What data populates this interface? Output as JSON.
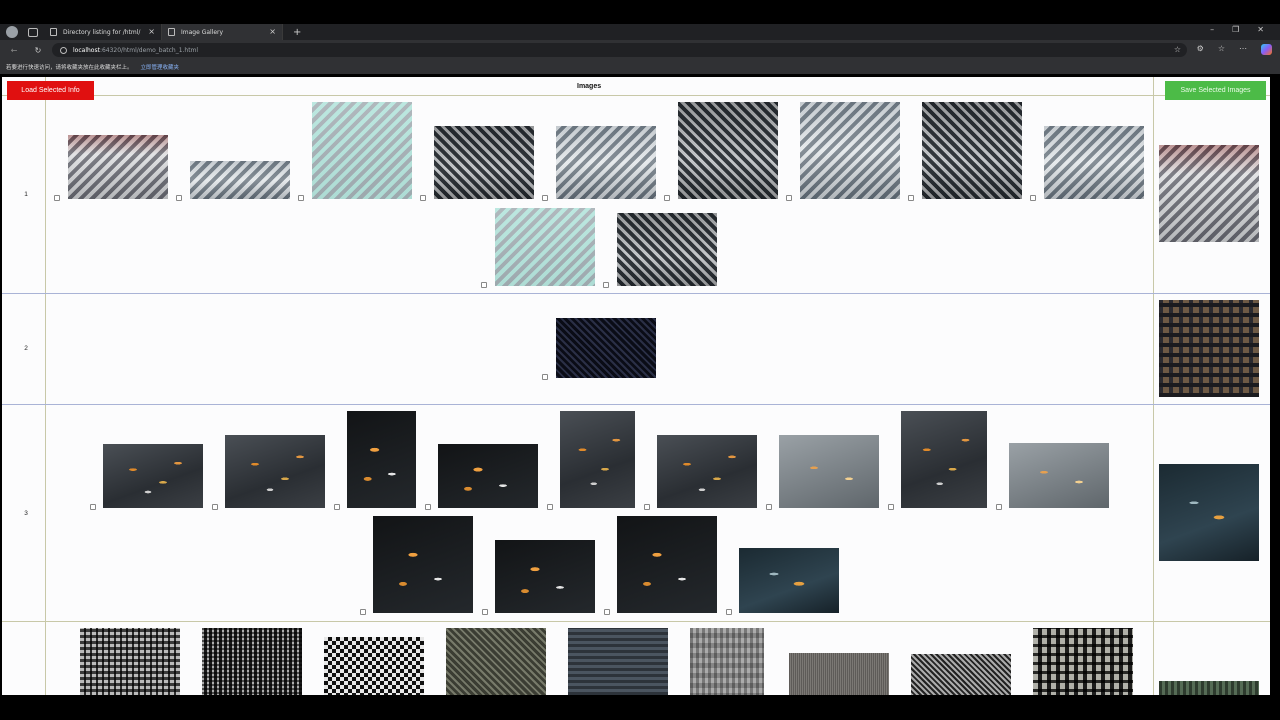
{
  "browser": {
    "tabs": [
      {
        "title": "Directory listing for /html/",
        "active": false
      },
      {
        "title": "Image Gallery",
        "active": true
      }
    ],
    "url_host": "localhost",
    "url_path": ":64320/html/demo_batch_1.html",
    "favorites_bar_text": "若要进行快速访问，请将收藏夹放在此收藏夹栏上。",
    "favorites_bar_link": "立即管理收藏夹"
  },
  "page": {
    "load_button_label": "Load Selected Info",
    "save_button_label": "Save Selected Images",
    "header_title": "Images",
    "accent_load": "#e01010",
    "accent_save": "#4cbb47",
    "rows": [
      {
        "number": "1"
      },
      {
        "number": "2"
      },
      {
        "number": "3"
      }
    ]
  }
}
